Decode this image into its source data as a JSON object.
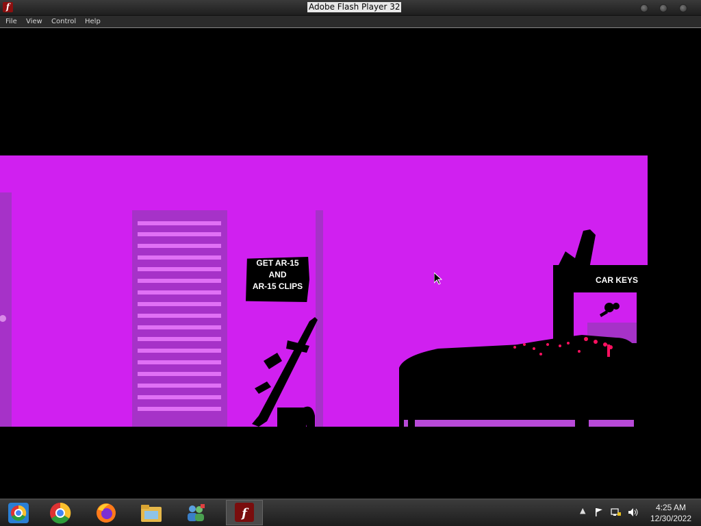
{
  "window": {
    "title": "Adobe Flash Player 32"
  },
  "menu": {
    "items": [
      "File",
      "View",
      "Control",
      "Help"
    ]
  },
  "game": {
    "sign_left": {
      "line1": "GET AR-15",
      "line2": "AND",
      "line3": "AR-15 CLIPS"
    },
    "sign_right": "CAR KEYS",
    "background_color": "#d020f0"
  },
  "taskbar": {
    "apps": [
      "chrome-app-icon",
      "chrome-icon",
      "firefox-icon",
      "file-explorer-icon",
      "network-people-icon",
      "flash-player-icon"
    ],
    "clock": {
      "time": "4:25 AM",
      "date": "12/30/2022"
    }
  }
}
